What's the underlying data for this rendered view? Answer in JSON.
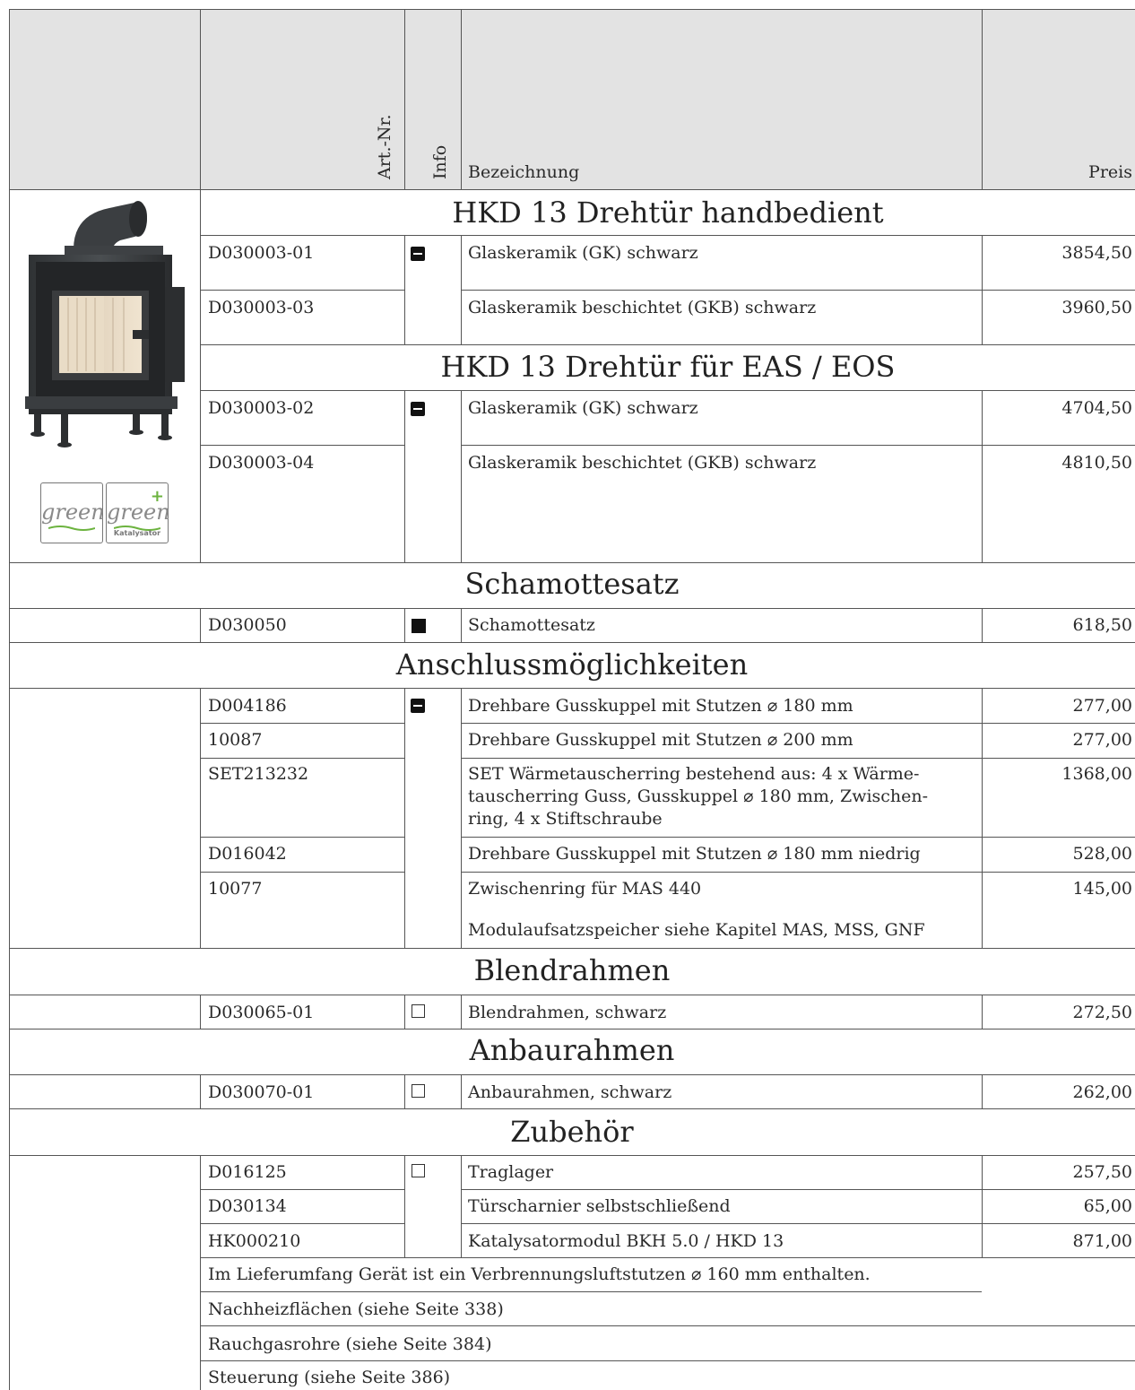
{
  "header": {
    "artnr": "Art.-Nr.",
    "info": "Info",
    "bezeichnung": "Bezeichnung",
    "preis": "Preis"
  },
  "sections": {
    "hkd_hand": {
      "title": "HKD 13 Drehtür handbedient",
      "rows": [
        {
          "art": "D030003-01",
          "desc": "Glaskeramik (GK) schwarz",
          "price": "3854,50"
        },
        {
          "art": "D030003-03",
          "desc": "Glaskeramik beschichtet (GKB) schwarz",
          "price": "3960,50"
        }
      ]
    },
    "hkd_eas": {
      "title": "HKD 13 Drehtür für EAS / EOS",
      "rows": [
        {
          "art": "D030003-02",
          "desc": "Glaskeramik (GK) schwarz",
          "price": "4704,50"
        },
        {
          "art": "D030003-04",
          "desc": "Glaskeramik beschichtet (GKB) schwarz",
          "price": "4810,50"
        }
      ]
    },
    "schamotte": {
      "title": "Schamottesatz",
      "rows": [
        {
          "art": "D030050",
          "desc": "Schamottesatz",
          "price": "618,50"
        }
      ]
    },
    "anschluss": {
      "title": "Anschlussmöglichkeiten",
      "rows": [
        {
          "art": "D004186",
          "desc": "Drehbare Gusskuppel mit Stutzen ⌀ 180 mm",
          "price": "277,00"
        },
        {
          "art": "10087",
          "desc": "Drehbare Gusskuppel mit Stutzen ⌀ 200 mm",
          "price": "277,00"
        },
        {
          "art": "SET213232",
          "desc": "SET Wärmetauscherring bestehend aus: 4 x Wärme-tauscherring Guss, Gusskuppel ⌀ 180 mm, Zwischen-ring, 4 x Stiftschraube",
          "desc_lines": [
            "SET Wärmetauscherring bestehend aus: 4 x Wärme-",
            "tauscherring Guss, Gusskuppel ⌀ 180 mm, Zwischen-",
            "ring, 4 x Stiftschraube"
          ],
          "price": "1368,00"
        },
        {
          "art": "D016042",
          "desc": "Drehbare Gusskuppel mit Stutzen ⌀ 180 mm niedrig",
          "price": "528,00"
        },
        {
          "art": "10077",
          "desc": "Zwischenring für MAS 440",
          "note": "Modulaufsatzspeicher siehe Kapitel MAS, MSS, GNF",
          "price": "145,00"
        }
      ]
    },
    "blend": {
      "title": "Blendrahmen",
      "rows": [
        {
          "art": "D030065-01",
          "desc": "Blendrahmen, schwarz",
          "price": "272,50"
        }
      ]
    },
    "anbau": {
      "title": "Anbaurahmen",
      "rows": [
        {
          "art": "D030070-01",
          "desc": "Anbaurahmen, schwarz",
          "price": "262,00"
        }
      ]
    },
    "zubehoer": {
      "title": "Zubehör",
      "rows": [
        {
          "art": "D016125",
          "desc": "Traglager",
          "price": "257,50"
        },
        {
          "art": "D030134",
          "desc": "Türscharnier selbstschließend",
          "price": "65,00"
        },
        {
          "art": "HK000210",
          "desc": "Katalysatormodul BKH 5.0 / HKD 13",
          "price": "871,00"
        }
      ],
      "notes": [
        "Im Lieferumfang Gerät ist ein Verbrennungsluftstutzen ⌀ 160 mm enthalten.",
        "Nachheizflächen (siehe Seite 338)",
        "Rauchgasrohre (siehe Seite 384)",
        "Steuerung (siehe Seite 386)"
      ]
    }
  },
  "logos": {
    "green": "green",
    "green_plus": "green",
    "katalysator": "Katalysator"
  },
  "colors": {
    "header_bg": "#e3e3e3",
    "green_accent": "#6cb33f"
  }
}
